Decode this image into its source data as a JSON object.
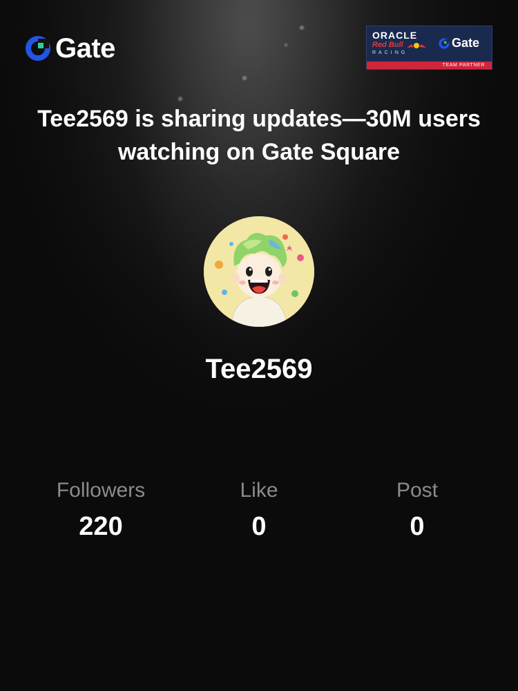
{
  "brand": {
    "name": "Gate",
    "accent": "#2354e6",
    "accent_green": "#2bd1a1"
  },
  "partner_badge": {
    "oracle": "ORACLE",
    "redbull": "Red Bull",
    "racing": "RACING",
    "gate": "Gate",
    "team_partner": "TEAM PARTNER",
    "colors": {
      "navy": "#1a2a4f",
      "red": "#d0253b"
    }
  },
  "headline": "Tee2569 is sharing updates—30M users watching on Gate Square",
  "profile": {
    "username": "Tee2569",
    "avatar_icon": "cartoon-boy-avatar"
  },
  "stats": [
    {
      "label": "Followers",
      "value": "220"
    },
    {
      "label": "Like",
      "value": "0"
    },
    {
      "label": "Post",
      "value": "0"
    }
  ]
}
